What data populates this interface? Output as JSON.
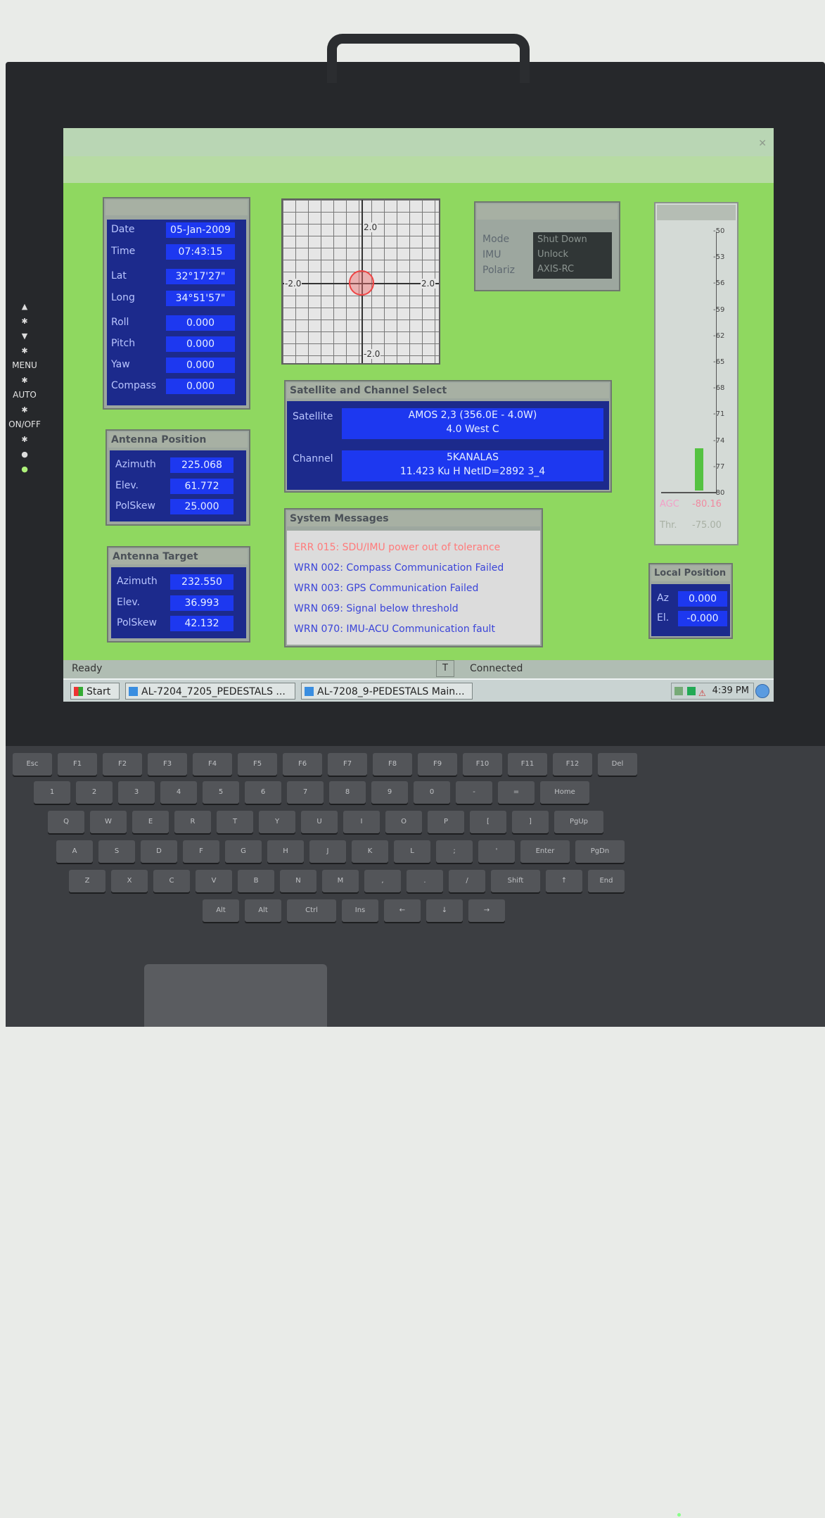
{
  "side_buttons": [
    "MENU",
    "AUTO",
    "ON/OFF"
  ],
  "graph": {
    "top_label": "2.0",
    "left_label": "-2.0",
    "right_label": "2.0",
    "bottom_label": "-2.0"
  },
  "position_panel": {
    "rows": [
      {
        "label": "Date",
        "value": "05-Jan-2009"
      },
      {
        "label": "Time",
        "value": "07:43:15"
      },
      {
        "label": "Lat",
        "value": "32°17'27\""
      },
      {
        "label": "Long",
        "value": "34°51'57\""
      },
      {
        "label": "Roll",
        "value": "0.000"
      },
      {
        "label": "Pitch",
        "value": "0.000"
      },
      {
        "label": "Yaw",
        "value": "0.000"
      },
      {
        "label": "Compass",
        "value": "0.000"
      }
    ]
  },
  "antenna_position": {
    "title": "Antenna Position",
    "rows": [
      {
        "label": "Azimuth",
        "value": "225.068"
      },
      {
        "label": "Elev.",
        "value": "61.772"
      },
      {
        "label": "PolSkew",
        "value": "25.000"
      }
    ]
  },
  "antenna_target": {
    "title": "Antenna Target",
    "rows": [
      {
        "label": "Azimuth",
        "value": "232.550"
      },
      {
        "label": "Elev.",
        "value": "36.993"
      },
      {
        "label": "PolSkew",
        "value": "42.132"
      }
    ]
  },
  "system_status": {
    "rows": [
      {
        "label": "Mode",
        "value": "Shut Down"
      },
      {
        "label": "IMU",
        "value": "Unlock"
      },
      {
        "label": "Polariz",
        "value": "AXIS-RC"
      }
    ]
  },
  "satellite_select": {
    "title": "Satellite and Channel Select",
    "satellite_label": "Satellite",
    "satellite_line1": "AMOS 2,3 (356.0E - 4.0W)",
    "satellite_line2": "4.0 West  C",
    "channel_label": "Channel",
    "channel_line1": "5KANALAS",
    "channel_line2": "11.423 Ku H NetID=2892 3_4"
  },
  "system_messages": {
    "title": "System Messages",
    "items": [
      {
        "text": "ERR 015: SDU/IMU power out of tolerance",
        "color": "#ff7a7a"
      },
      {
        "text": "WRN 002: Compass Communication Failed",
        "color": "#3a44d8"
      },
      {
        "text": "WRN 003: GPS Communication Failed",
        "color": "#3a44d8"
      },
      {
        "text": "WRN 069: Signal below threshold",
        "color": "#3a44d8"
      },
      {
        "text": "WRN 070: IMU-ACU Communication fault",
        "color": "#3a44d8"
      }
    ]
  },
  "signal": {
    "ticks": [
      "-50",
      "-53",
      "-56",
      "-59",
      "-62",
      "-65",
      "-68",
      "-71",
      "-74",
      "-77",
      "-80"
    ],
    "agc_label": "AGC",
    "agc_value": "-80.16",
    "thr_label": "Thr.",
    "thr_value": "-75.00"
  },
  "local_position": {
    "title": "Local Position",
    "rows": [
      {
        "label": "Az",
        "value": "0.000"
      },
      {
        "label": "El.",
        "value": "-0.000"
      }
    ]
  },
  "status_bar": {
    "left": "Ready",
    "indicator": "T",
    "right": "Connected"
  },
  "taskbar": {
    "start_label": "Start",
    "tasks": [
      "AL-7204_7205_PEDESTALS ...",
      "AL-7208_9-PEDESTALS Main..."
    ],
    "clock": "4:39 PM"
  },
  "keyboard": {
    "row1": [
      "Esc",
      "F1",
      "F2",
      "F3",
      "F4",
      "F5",
      "F6",
      "F7",
      "F8",
      "F9",
      "F10",
      "F11",
      "F12",
      "Del"
    ],
    "row2": [
      "1",
      "2",
      "3",
      "4",
      "5",
      "6",
      "7",
      "8",
      "9",
      "0",
      "-",
      "=",
      "Home"
    ],
    "row3": [
      "Q",
      "W",
      "E",
      "R",
      "T",
      "Y",
      "U",
      "I",
      "O",
      "P",
      "[",
      "]",
      "PgUp"
    ],
    "row4": [
      "A",
      "S",
      "D",
      "F",
      "G",
      "H",
      "J",
      "K",
      "L",
      ";",
      "'",
      "Enter",
      "PgDn"
    ],
    "row5": [
      "Z",
      "X",
      "C",
      "V",
      "B",
      "N",
      "M",
      ",",
      ".",
      "/",
      "Shift",
      "↑",
      "End"
    ],
    "row6": [
      "Alt",
      "Alt",
      "Ctrl",
      "Ins",
      "←",
      "↓",
      "→"
    ]
  }
}
